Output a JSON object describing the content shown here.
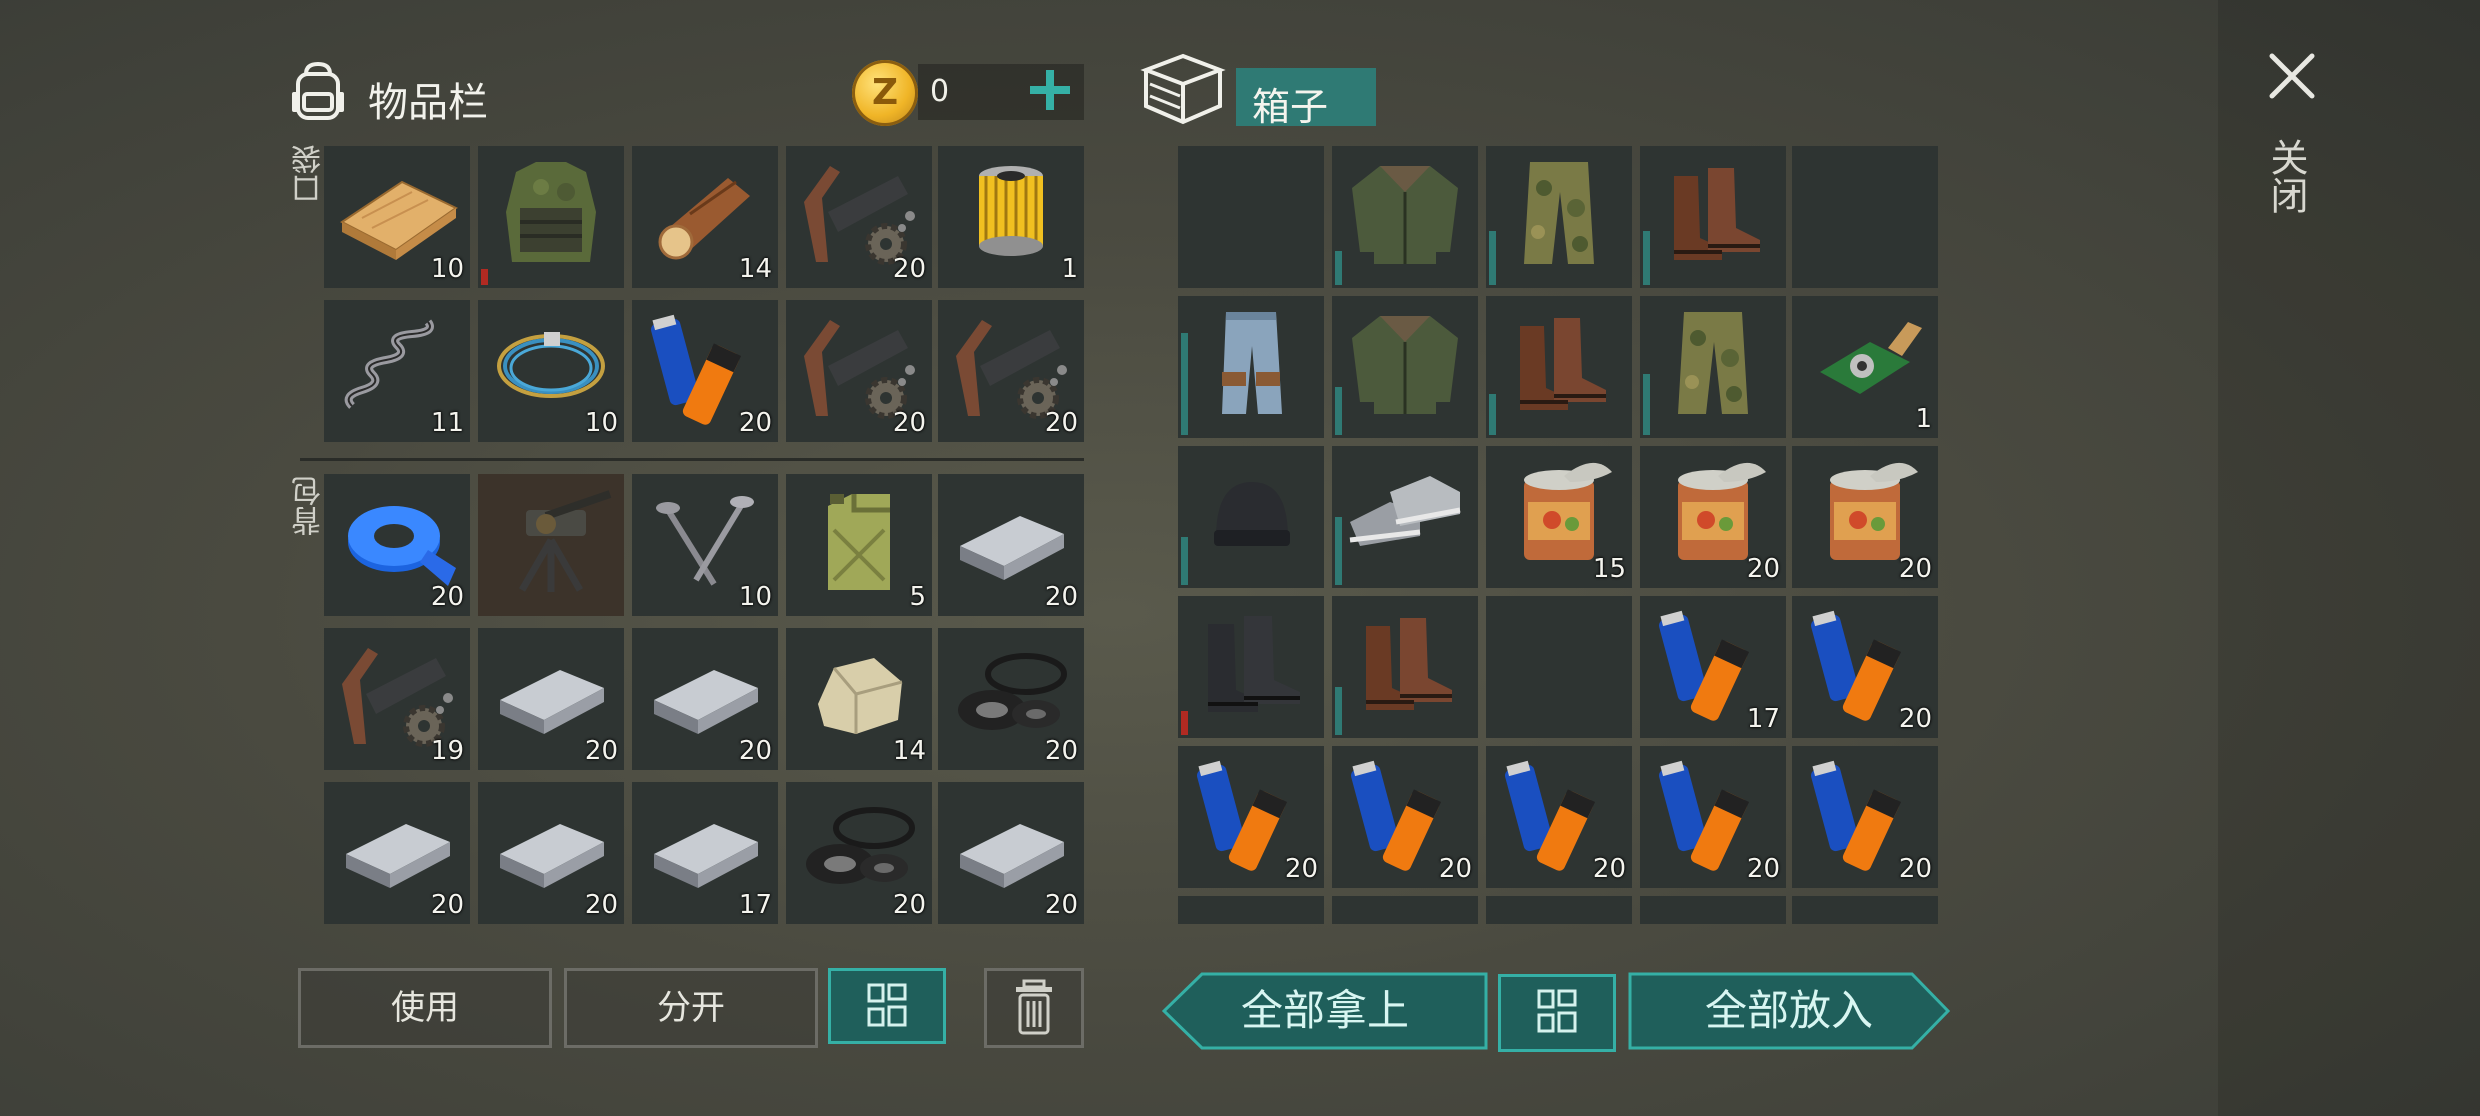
{
  "inventory": {
    "title": "物品栏",
    "pocket_label": "口袋",
    "backpack_label": "背包",
    "coins": "0",
    "pocket": [
      {
        "item": "wooden-plank",
        "qty": "10"
      },
      {
        "item": "military-vest",
        "qty": "",
        "durability": 0.12,
        "durability_color": "#b12a22"
      },
      {
        "item": "log",
        "qty": "14"
      },
      {
        "item": "gun-parts",
        "qty": "20"
      },
      {
        "item": "oil-filter",
        "qty": "1"
      },
      {
        "item": "spring",
        "qty": "11"
      },
      {
        "item": "wire-coil",
        "qty": "10"
      },
      {
        "item": "batteries",
        "qty": "20"
      },
      {
        "item": "gun-parts",
        "qty": "20"
      },
      {
        "item": "gun-parts",
        "qty": "20"
      }
    ],
    "backpack": [
      {
        "item": "duct-tape",
        "qty": "20"
      },
      {
        "item": "mounted-turret",
        "qty": ""
      },
      {
        "item": "nails",
        "qty": "10"
      },
      {
        "item": "jerrycan",
        "qty": "5"
      },
      {
        "item": "iron-ingot",
        "qty": "20"
      },
      {
        "item": "gun-parts",
        "qty": "19"
      },
      {
        "item": "iron-ingot",
        "qty": "20"
      },
      {
        "item": "iron-ingot",
        "qty": "20"
      },
      {
        "item": "stone",
        "qty": "14"
      },
      {
        "item": "rubber-gaskets",
        "qty": "20"
      },
      {
        "item": "iron-ingot",
        "qty": "20"
      },
      {
        "item": "iron-ingot",
        "qty": "20"
      },
      {
        "item": "iron-ingot",
        "qty": "17"
      },
      {
        "item": "rubber-gaskets",
        "qty": "20"
      },
      {
        "item": "iron-ingot",
        "qty": "20"
      }
    ],
    "buttons": {
      "use": "使用",
      "split": "分开"
    }
  },
  "box": {
    "title": "箱子",
    "slots": [
      {
        "item": "",
        "qty": ""
      },
      {
        "item": "bomber-jacket",
        "qty": "",
        "durability": 0.25
      },
      {
        "item": "camo-pants",
        "qty": "",
        "durability": 0.4
      },
      {
        "item": "leather-boots",
        "qty": "",
        "durability": 0.4
      },
      {
        "item": "",
        "qty": ""
      },
      {
        "item": "jeans",
        "qty": "",
        "durability": 0.75
      },
      {
        "item": "bomber-jacket",
        "qty": "",
        "durability": 0.35
      },
      {
        "item": "leather-boots",
        "qty": "",
        "durability": 0.3
      },
      {
        "item": "camo-pants",
        "qty": "",
        "durability": 0.45
      },
      {
        "item": "circuit-board",
        "qty": "1"
      },
      {
        "item": "beanie",
        "qty": "",
        "durability": 0.35
      },
      {
        "item": "sneakers",
        "qty": "",
        "durability": 0.5
      },
      {
        "item": "canned-food",
        "qty": "15"
      },
      {
        "item": "canned-food",
        "qty": "20"
      },
      {
        "item": "canned-food",
        "qty": "20"
      },
      {
        "item": "combat-boots",
        "qty": "",
        "durability": 0.18,
        "durability_color": "#b12a22"
      },
      {
        "item": "leather-boots",
        "qty": "",
        "durability": 0.35
      },
      {
        "item": "",
        "qty": ""
      },
      {
        "item": "batteries",
        "qty": "17"
      },
      {
        "item": "batteries",
        "qty": "20"
      },
      {
        "item": "batteries",
        "qty": "20"
      },
      {
        "item": "batteries",
        "qty": "20"
      },
      {
        "item": "batteries",
        "qty": "20"
      },
      {
        "item": "batteries",
        "qty": "20"
      },
      {
        "item": "batteries",
        "qty": "20"
      }
    ],
    "buttons": {
      "take_all": "全部拿上",
      "put_all": "全部放入"
    }
  },
  "close_label": "关闭",
  "colors": {
    "accent": "#35b0a6",
    "accent_dark": "#1f5f5b",
    "slot": "#2e3432",
    "durability_bad": "#b12a22"
  }
}
